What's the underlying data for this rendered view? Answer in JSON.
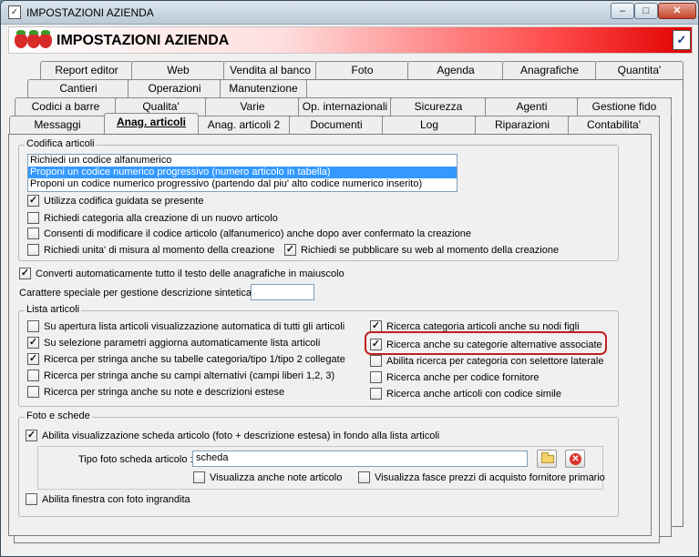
{
  "window": {
    "title": "IMPOSTAZIONI AZIENDA",
    "minimize_glyph": "–",
    "maximize_glyph": "□",
    "close_glyph": "✕"
  },
  "header": {
    "title": "IMPOSTAZIONI AZIENDA",
    "logo_icon": "strawberry-icon",
    "confirm_icon": "checklist-icon"
  },
  "tabs": {
    "row1": [
      "Report editor",
      "Web",
      "Vendita al banco",
      "Foto",
      "Agenda",
      "Anagrafiche",
      "Quantita'"
    ],
    "row2": [
      "Cantieri",
      "Operazioni",
      "Manutenzione"
    ],
    "row3": [
      "Codici a barre",
      "Qualita'",
      "Varie",
      "Op. internazionali",
      "Sicurezza",
      "Agenti",
      "Gestione fido"
    ],
    "row4": [
      "Messaggi",
      "Anag. articoli",
      "Anag. articoli 2",
      "Documenti",
      "Log",
      "Riparazioni",
      "Contabilita'"
    ],
    "active": "Anag. articoli"
  },
  "codifica": {
    "legend": "Codifica articoli",
    "options": [
      "Richiedi un codice alfanumerico",
      "Proponi un codice numerico progressivo (numero articolo in tabella)",
      "Proponi un codice numerico progressivo (partendo dal piu' alto codice numerico inserito)"
    ],
    "selected_index": 1,
    "checks": [
      {
        "label": "Utilizza codifica guidata se presente",
        "checked": true
      },
      {
        "label": "Richiedi categoria alla creazione di un nuovo articolo",
        "checked": false
      },
      {
        "label": "Consenti di modificare il codice articolo (alfanumerico) anche dopo aver confermato la creazione",
        "checked": false
      },
      {
        "label": "Richiedi unita' di misura al momento della creazione",
        "checked": false
      },
      {
        "label": "Richiedi se pubblicare su web al momento della creazione",
        "checked": true
      }
    ]
  },
  "general": {
    "uppercase_label": "Converti automaticamente tutto il testo delle anagrafiche in maiuscolo",
    "uppercase_checked": true,
    "special_char_label": "Carattere speciale per gestione descrizione sintetica :",
    "special_char_value": ""
  },
  "lista": {
    "legend": "Lista articoli",
    "left": [
      {
        "label": "Su apertura lista articoli visualizzazione automatica di tutti gli articoli",
        "checked": false
      },
      {
        "label": "Su selezione parametri aggiorna automaticamente lista articoli",
        "checked": true
      },
      {
        "label": "Ricerca per stringa anche su tabelle categoria/tipo 1/tipo 2 collegate",
        "checked": true
      },
      {
        "label": "Ricerca per stringa anche su campi alternativi (campi liberi 1,2, 3)",
        "checked": false
      },
      {
        "label": "Ricerca per stringa anche su note e descrizioni estese",
        "checked": false
      }
    ],
    "right": [
      {
        "label": "Ricerca categoria articoli anche su nodi figli",
        "checked": true
      },
      {
        "label": "Ricerca anche su categorie alternative associate",
        "checked": true
      },
      {
        "label": "Abilita ricerca per categoria con selettore laterale",
        "checked": false
      },
      {
        "label": "Ricerca anche per codice fornitore",
        "checked": false
      },
      {
        "label": "Ricerca anche articoli con codice simile",
        "checked": false
      }
    ]
  },
  "foto": {
    "legend": "Foto e schede",
    "enable_label": "Abilita visualizzazione scheda articolo (foto + descrizione estesa) in fondo alla lista articoli",
    "enable_checked": true,
    "tipo_label": "Tipo foto scheda articolo :",
    "tipo_value": "scheda",
    "note_label": "Visualizza anche note articolo",
    "note_checked": false,
    "fasce_label": "Visualizza fasce prezzi di acquisto fornitore primario",
    "fasce_checked": false,
    "enlarge_label": "Abilita finestra con foto ingrandita",
    "enlarge_checked": false
  },
  "colors": {
    "selection": "#3399ff",
    "highlight_ring": "#c0201e",
    "banner_red": "#e00000"
  }
}
